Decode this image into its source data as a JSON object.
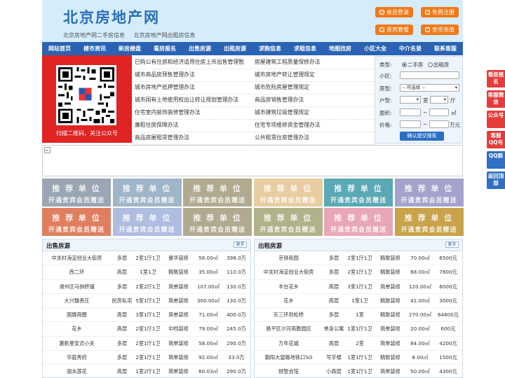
{
  "header": {
    "logo": "北京房地产网",
    "sublinks": [
      "北京房地产网二手房信息",
      "北京房地产网出租房信息"
    ],
    "buttons": [
      "会员登录",
      "免费注册",
      "贵宾套餐",
      "金币充值"
    ]
  },
  "nav": [
    "网站首页",
    "楼市资讯",
    "新房楼盘",
    "看房报名",
    "出售房源",
    "出租房源",
    "求购信息",
    "求租信息",
    "地图找房",
    "小区大全",
    "中介名录",
    "联系客服"
  ],
  "qr": {
    "caption": "扫描二维码，关注公众号"
  },
  "news_left": [
    "已购公有住房和经济适用住房上市出售管理暂",
    "城市商品房预售管理办法",
    "城市房地产抵押管理办法",
    "城市国有土地使用权出让转让规划管理办法",
    "住宅室内装饰装修管理办法",
    "廉租住房保障办法",
    "商品房屋租赁管理办法"
  ],
  "news_right": [
    "房屋建筑工程质量保修办法",
    "城市房地产转让管理规定",
    "城市危险房屋管理规定",
    "商品房销售管理办法",
    "城市建筑垃圾管理规定",
    "住宅专项维修资金管理办法",
    "公共租赁住房管理办法"
  ],
  "search": {
    "type_label": "类型:",
    "opt_sale": "二手房",
    "opt_rent": "出租房",
    "community_label": "小区:",
    "layout_label": "房型:",
    "layout_value": "-- 可选择 --",
    "room_label": "户型:",
    "room_unit": "室",
    "hall_unit": "厅",
    "area_label": "面积:",
    "area_unit": "㎡",
    "price_label": "价格:",
    "price_unit": "万元",
    "tilde": "~",
    "submit": "确认提交搜索"
  },
  "promo": {
    "line1": "推 荐 单 位",
    "line2": "开通贵宾会员赠送"
  },
  "promo_colors": [
    "#9aa6b4",
    "#9fb5c9",
    "#b1aa90",
    "#e8cda0",
    "#5aa9b5",
    "#a3a3cc",
    "#e07f60",
    "#aebde0",
    "#b1aa90",
    "#b1b28a",
    "#e8a7b8",
    "#c9a34a"
  ],
  "sale": {
    "title": "出售房源",
    "more": "更多",
    "rows": [
      [
        "中关村海淀创业大街房",
        "多层",
        "2室1厅1卫",
        "豪华装修",
        "58.00㎡",
        "398.0万"
      ],
      [
        "西二环",
        "高层",
        "1室1卫",
        "精致装修",
        "35.00㎡",
        "110.0万"
      ],
      [
        "通州区马驹桥镇",
        "多层",
        "2室2厅1卫",
        "简单装修",
        "107.00㎡",
        "130.0万"
      ],
      [
        "大兴魏善庄",
        "民房私宅",
        "5室1厅1卫",
        "简单装修",
        "300.00㎡",
        "130.0万"
      ],
      [
        "国展商圈",
        "高层",
        "3室1厅1卫",
        "简单装修",
        "71.00㎡",
        "400.0万"
      ],
      [
        "花乡",
        "高层",
        "2室1厅1卫",
        "中档装修",
        "79.00㎡",
        "245.0万"
      ],
      [
        "惠新里安贞小关",
        "多层",
        "2室1厅1卫",
        "简单装修",
        "58.00㎡",
        "290.0万"
      ],
      [
        "华庭秀府",
        "多层",
        "2室1厅1卫",
        "简单装修",
        "92.00㎡",
        "33.0万"
      ],
      [
        "丽水莲花",
        "高层",
        "1室2厅1卫",
        "简单装修",
        "60.03㎡",
        "290.0万"
      ],
      [
        "通州土桥",
        "写字楼",
        "—",
        "毛坯未装",
        "100.00㎡",
        "270.0万"
      ]
    ]
  },
  "rent": {
    "title": "出租房源",
    "more": "更多",
    "rows": [
      [
        "京铁和园",
        "多层",
        "2室1厅1卫",
        "精致装修",
        "70.00㎡",
        "6500元"
      ],
      [
        "中关村海淀创业大街房",
        "多层",
        "2室1厅1卫",
        "精致装修",
        "68.00㎡",
        "7800元"
      ],
      [
        "丰台花乡",
        "高层",
        "3室1厅1卫",
        "简单装修",
        "120.00㎡",
        "6000元"
      ],
      [
        "花乡",
        "高层",
        "1室1卫",
        "精致装修",
        "41.00㎡",
        "3000元"
      ],
      [
        "东三环劲松桥",
        "多层",
        "1室",
        "精致装修",
        "270.00㎡",
        "64800元"
      ],
      [
        "昌平区沙河高教园区",
        "单身公寓",
        "1室1厅1卫",
        "简单装修",
        "20.00㎡",
        "600元"
      ],
      [
        "万年花城",
        "高层",
        "2室",
        "简单装修",
        "84.00㎡",
        "4200元"
      ],
      [
        "朝阳大望路地铁口SO",
        "写字楼",
        "1室1厅1卫",
        "精致装修",
        "8.00㎡",
        "1500元"
      ],
      [
        "财智会馆",
        "小高层",
        "1室1厅1卫",
        "简单装修",
        "50.00㎡",
        "4300元"
      ],
      [
        "世界之花假日广场",
        "单身公寓",
        "1室",
        "精致装修",
        "45.00㎡",
        "2550元"
      ]
    ]
  },
  "side": [
    "看房报名",
    "客服微信",
    "公众号",
    "客服QQ号",
    "QQ群",
    "返回顶部"
  ]
}
